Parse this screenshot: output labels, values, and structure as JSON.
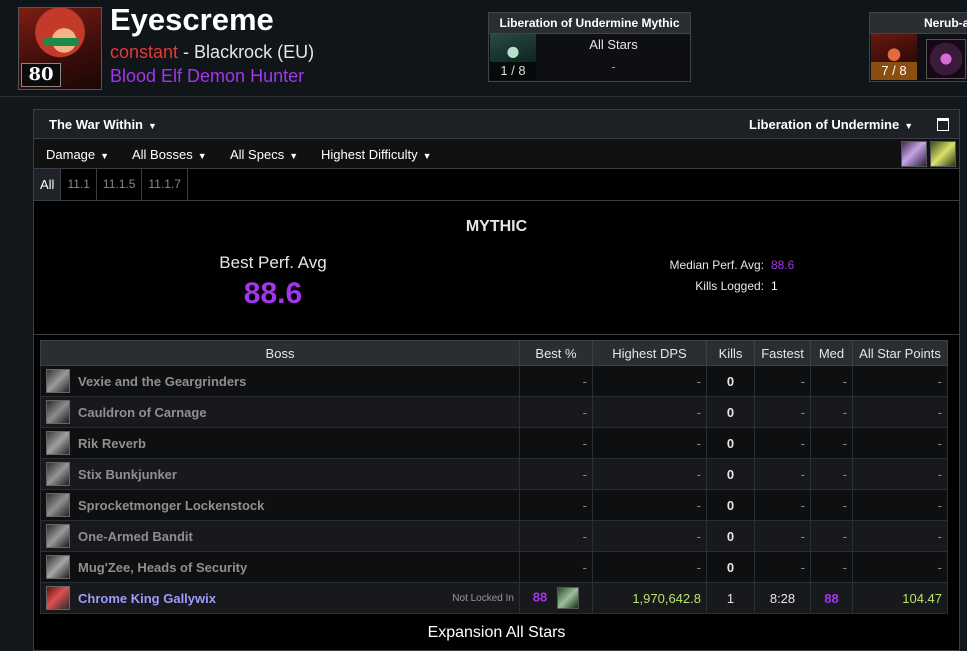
{
  "character": {
    "level": "80",
    "name": "Eyescreme",
    "guild": "constant",
    "separator": " - ",
    "realm": "Blackrock (EU)",
    "class_spec": "Blood Elf Demon Hunter"
  },
  "raid_cards": [
    {
      "title": "Liberation of Undermine Mythic",
      "progress": "1 / 8",
      "label": "All Stars",
      "value": "-"
    },
    {
      "title": "Nerub-a",
      "progress": "7 / 8"
    }
  ],
  "filters": {
    "expansion": "The War Within",
    "zone": "Liberation of Undermine",
    "metric": "Damage",
    "bosses": "All Bosses",
    "specs": "All Specs",
    "difficulty": "Highest Difficulty"
  },
  "patch_tabs": [
    "All",
    "11.1",
    "11.1.5",
    "11.1.7"
  ],
  "summary": {
    "difficulty_title": "MYTHIC",
    "best_perf_label": "Best Perf. Avg",
    "best_perf_value": "88.6",
    "median_label": "Median Perf. Avg:",
    "median_value": "88.6",
    "kills_label": "Kills Logged:",
    "kills_value": "1"
  },
  "table": {
    "headers": [
      "Boss",
      "Best %",
      "Highest DPS",
      "Kills",
      "Fastest",
      "Med",
      "All Star Points"
    ],
    "rows": [
      {
        "boss": "Vexie and the Geargrinders",
        "best": "-",
        "dps": "-",
        "kills": "0",
        "fastest": "-",
        "med": "-",
        "points": "-"
      },
      {
        "boss": "Cauldron of Carnage",
        "best": "-",
        "dps": "-",
        "kills": "0",
        "fastest": "-",
        "med": "-",
        "points": "-"
      },
      {
        "boss": "Rik Reverb",
        "best": "-",
        "dps": "-",
        "kills": "0",
        "fastest": "-",
        "med": "-",
        "points": "-"
      },
      {
        "boss": "Stix Bunkjunker",
        "best": "-",
        "dps": "-",
        "kills": "0",
        "fastest": "-",
        "med": "-",
        "points": "-"
      },
      {
        "boss": "Sprocketmonger Lockenstock",
        "best": "-",
        "dps": "-",
        "kills": "0",
        "fastest": "-",
        "med": "-",
        "points": "-"
      },
      {
        "boss": "One-Armed Bandit",
        "best": "-",
        "dps": "-",
        "kills": "0",
        "fastest": "-",
        "med": "-",
        "points": "-"
      },
      {
        "boss": "Mug'Zee, Heads of Security",
        "best": "-",
        "dps": "-",
        "kills": "0",
        "fastest": "-",
        "med": "-",
        "points": "-"
      },
      {
        "boss": "Chrome King Gallywix",
        "note": "Not Locked In",
        "best": "88",
        "dps": "1,970,642.8",
        "kills": "1",
        "fastest": "8:28",
        "med": "88",
        "points": "104.47"
      }
    ]
  },
  "footer": {
    "section_title": "Expansion All Stars"
  },
  "colors": {
    "legendary_purple": "#a335ee",
    "guild_red": "#e53935",
    "points_green": "#b7e36a",
    "boss_link": "#9d9cff"
  },
  "icons": [
    "character-portrait-icon",
    "raid-boss-thumbnail-icon",
    "window-toggle-icon",
    "demon-hunter-spec-icon",
    "key-icon",
    "boss-portrait-icon",
    "hero-talent-icon",
    "dropdown-caret-icon"
  ]
}
